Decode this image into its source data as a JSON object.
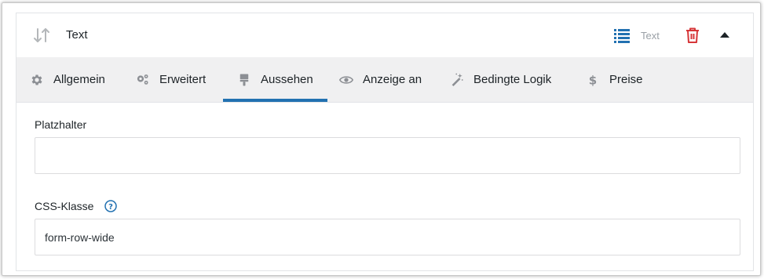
{
  "field": {
    "title": "Text",
    "type_label": "Text",
    "icons": {
      "sort": "sort-arrows-icon",
      "list": "list-icon",
      "delete": "trash-icon",
      "collapse": "caret-up-icon"
    }
  },
  "tabs": [
    {
      "label": "Allgemein",
      "icon": "gear-icon",
      "active": false
    },
    {
      "label": "Erweitert",
      "icon": "gears-icon",
      "active": false
    },
    {
      "label": "Aussehen",
      "icon": "paintbrush-icon",
      "active": true
    },
    {
      "label": "Anzeige an",
      "icon": "eye-icon",
      "active": false
    },
    {
      "label": "Bedingte Logik",
      "icon": "magic-wand-icon",
      "active": false
    },
    {
      "label": "Preise",
      "icon": "dollar-icon",
      "active": false
    }
  ],
  "form": {
    "placeholder_label": "Platzhalter",
    "placeholder_value": "",
    "css_class_label": "CSS-Klasse",
    "css_class_value": "form-row-wide"
  },
  "colors": {
    "accent": "#2271b1",
    "danger": "#d63638",
    "tab_bar": "#f0f0f1",
    "icon_gray": "#8c8f94"
  }
}
